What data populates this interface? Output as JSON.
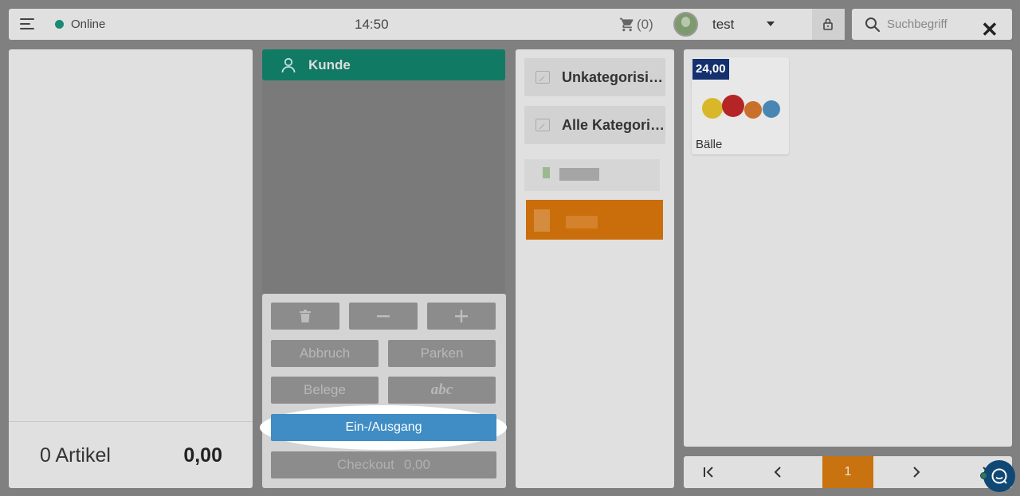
{
  "header": {
    "status_text": "Online",
    "status_color": "#1a8a74",
    "time": "14:50",
    "cart_count": "(0)",
    "user_name": "test",
    "icons": [
      "menu-icon",
      "cart-icon",
      "chevron-down-icon",
      "lock-icon"
    ]
  },
  "search": {
    "placeholder": "Suchbegriff",
    "icon": "search-icon",
    "close_icon": "close-icon"
  },
  "cart": {
    "article_count": "0 Artikel",
    "total": "0,00"
  },
  "customer": {
    "label": "Kunde",
    "icon": "user-icon",
    "color": "#117a65"
  },
  "actions": {
    "delete_icon": "trash-icon",
    "minus_icon": "minus-icon",
    "plus_icon": "plus-icon",
    "cancel": "Abbruch",
    "park": "Parken",
    "receipts": "Belege",
    "text_input": "abc",
    "cash_in_out": "Ein-/Ausgang",
    "checkout": "Checkout",
    "checkout_total": "0,00"
  },
  "categories": {
    "items": [
      {
        "label": "Unkategorisi…",
        "icon": "image-icon"
      },
      {
        "label": "Alle Kategori…",
        "icon": "image-icon"
      }
    ],
    "selected_color": "#c96e0a"
  },
  "products": [
    {
      "name": "Bälle",
      "price": "24,00",
      "badge_color": "#14306e"
    }
  ],
  "pagination": {
    "current_page": "1",
    "first_icon": "first-page-icon",
    "prev_icon": "chevron-left-icon",
    "next_icon": "chevron-right-icon",
    "last_icon": "last-page-icon"
  },
  "chat": {
    "icon": "chat-icon"
  }
}
